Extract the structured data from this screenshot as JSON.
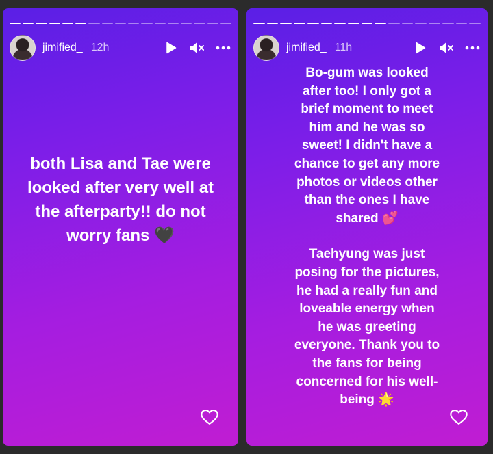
{
  "stories": [
    {
      "username": "jimified_",
      "time": "12h",
      "progress_total": 17,
      "progress_done": 6,
      "text": "both Lisa and Tae were\nlooked after very well at\nthe afterparty!! do not\nworry fans",
      "emoji": "🖤"
    },
    {
      "username": "jimified_",
      "time": "11h",
      "progress_total": 17,
      "progress_done": 10,
      "para1": "Bo-gum was looked\nafter too! I only got a\nbrief moment to meet\nhim and he was so\nsweet! I didn't have a\nchance to get any more\nphotos or videos other\nthan the ones I have\nshared",
      "emoji1": "💕",
      "para2": "Taehyung was just\nposing for the pictures,\nhe had a really fun and\nloveable energy when\nhe was greeting\neveryone. Thank you to\nthe fans for being\nconcerned for his well-\nbeing",
      "emoji2": "🌟"
    }
  ],
  "icons": {
    "play": "play-icon",
    "mute": "speaker-muted-icon",
    "more": "more-icon",
    "like": "heart-outline-icon"
  }
}
